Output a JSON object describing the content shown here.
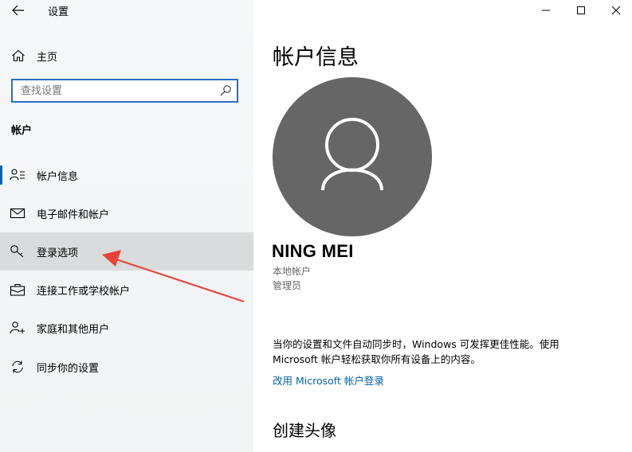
{
  "window": {
    "title": "设置"
  },
  "sidebar": {
    "home_label": "主页",
    "search_placeholder": "查找设置",
    "section_title": "帐户",
    "items": [
      {
        "label": "帐户信息"
      },
      {
        "label": "电子邮件和帐户"
      },
      {
        "label": "登录选项"
      },
      {
        "label": "连接工作或学校帐户"
      },
      {
        "label": "家庭和其他用户"
      },
      {
        "label": "同步你的设置"
      }
    ]
  },
  "main": {
    "title": "帐户信息",
    "user_name": "NING MEI",
    "account_type": "本地帐户",
    "account_role": "管理员",
    "sync_text": "当你的设置和文件自动同步时，Windows 可发挥更佳性能。使用 Microsoft 帐户轻松获取你所有设备上的内容。",
    "ms_link": "改用 Microsoft 帐户登录",
    "section2_title": "创建头像"
  },
  "colors": {
    "accent": "#0063b1",
    "arrow": "#e8443a",
    "avatar_bg": "#666666"
  }
}
